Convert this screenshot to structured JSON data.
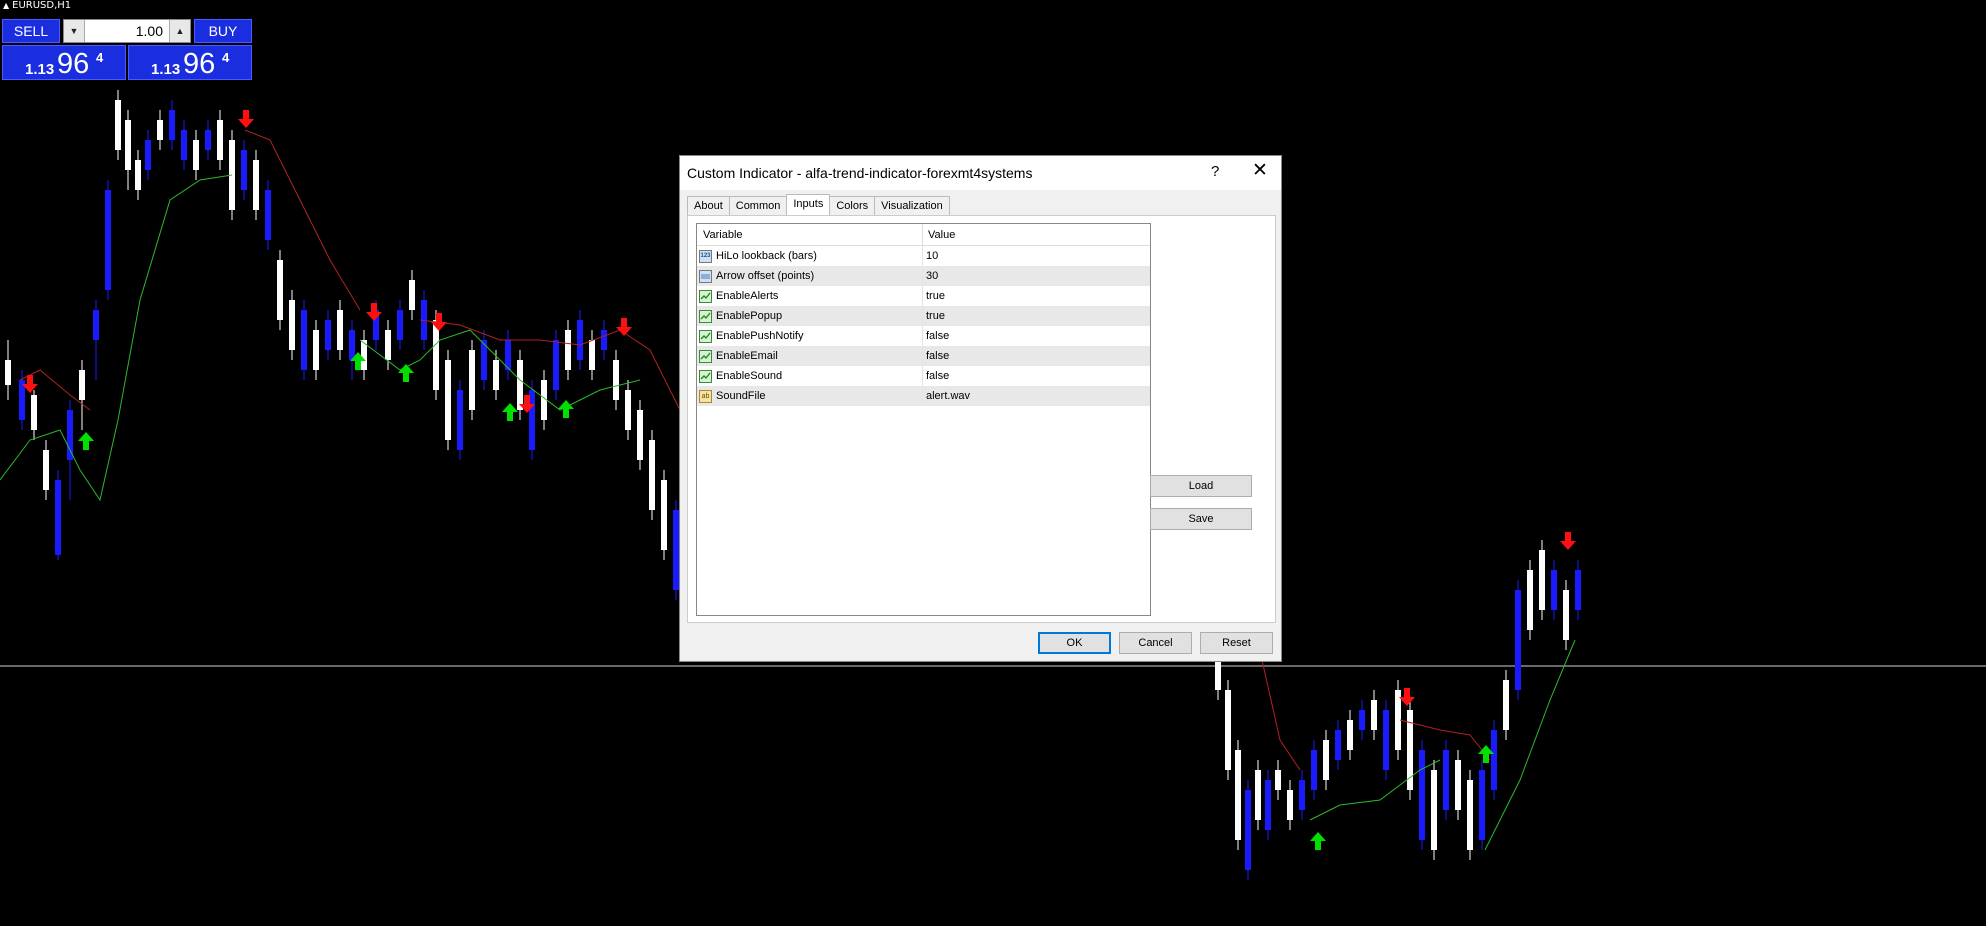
{
  "chart": {
    "symbol": "EURUSD,H1"
  },
  "trade_panel": {
    "sell_label": "SELL",
    "buy_label": "BUY",
    "lot_value": "1.00",
    "bid": {
      "big": "1.13",
      "main": "96",
      "small": "4"
    },
    "ask": {
      "big": "1.13",
      "main": "96",
      "small": "4"
    }
  },
  "dialog": {
    "title": "Custom Indicator - alfa-trend-indicator-forexmt4systems",
    "help": "?",
    "close": "✕",
    "tabs": [
      "About",
      "Common",
      "Inputs",
      "Colors",
      "Visualization"
    ],
    "active_tab": "Inputs",
    "columns": [
      "Variable",
      "Value"
    ],
    "params": [
      {
        "icon": "123",
        "type": "num",
        "name": "HiLo lookback (bars)",
        "value": "10"
      },
      {
        "icon": "",
        "type": "num",
        "name": "Arrow offset (points)",
        "value": "30"
      },
      {
        "icon": "",
        "type": "bool",
        "name": "EnableAlerts",
        "value": "true"
      },
      {
        "icon": "",
        "type": "bool",
        "name": "EnablePopup",
        "value": "true"
      },
      {
        "icon": "",
        "type": "bool",
        "name": "EnablePushNotify",
        "value": "false"
      },
      {
        "icon": "",
        "type": "bool",
        "name": "EnableEmail",
        "value": "false"
      },
      {
        "icon": "",
        "type": "bool",
        "name": "EnableSound",
        "value": "false"
      },
      {
        "icon": "ab",
        "type": "str",
        "name": "SoundFile",
        "value": "alert.wav"
      }
    ],
    "buttons": {
      "load": "Load",
      "save": "Save",
      "ok": "OK",
      "cancel": "Cancel",
      "reset": "Reset"
    }
  },
  "colors": {
    "background": "#000000",
    "bull_candle": "#ffffff",
    "bear_candle": "#1a1aff",
    "line_up": "#2db82d",
    "line_down": "#b02222",
    "arrow_up": "#00e000",
    "arrow_down": "#ff1010",
    "panel_blue": "#1a2ee0"
  }
}
